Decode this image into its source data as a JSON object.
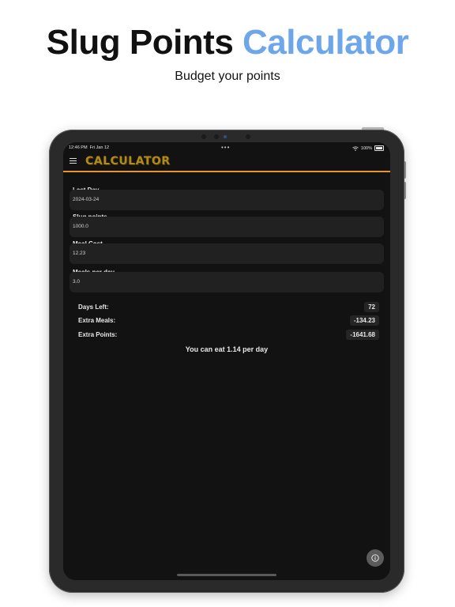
{
  "marketing": {
    "title_part1": "Slug Points",
    "title_part2": "Calculator",
    "subtitle": "Budget your points"
  },
  "status_bar": {
    "time": "12:46 PM",
    "date": "Fri Jan 12",
    "dots": "•••",
    "battery": "100%"
  },
  "app_bar": {
    "title": "CALCULATOR"
  },
  "form": {
    "fields": [
      {
        "label": "Last Day",
        "value": "2024-03-24"
      },
      {
        "label": "Slug points",
        "value": "1000.0"
      },
      {
        "label": "Meal Cost",
        "value": "12.23"
      },
      {
        "label": "Meals per day",
        "value": "3.0"
      }
    ]
  },
  "results": [
    {
      "label": "Days Left:",
      "value": "72"
    },
    {
      "label": "Extra Meals:",
      "value": "-134.23"
    },
    {
      "label": "Extra Points:",
      "value": "-1641.68"
    }
  ],
  "summary": "You can eat 1.14 per day",
  "info_icon": "info-icon",
  "colors": {
    "accent_blue": "#6ea6ea",
    "app_bar_underline": "#e7942a",
    "title_gold": "#b08a1c",
    "screen_bg": "#121212"
  }
}
